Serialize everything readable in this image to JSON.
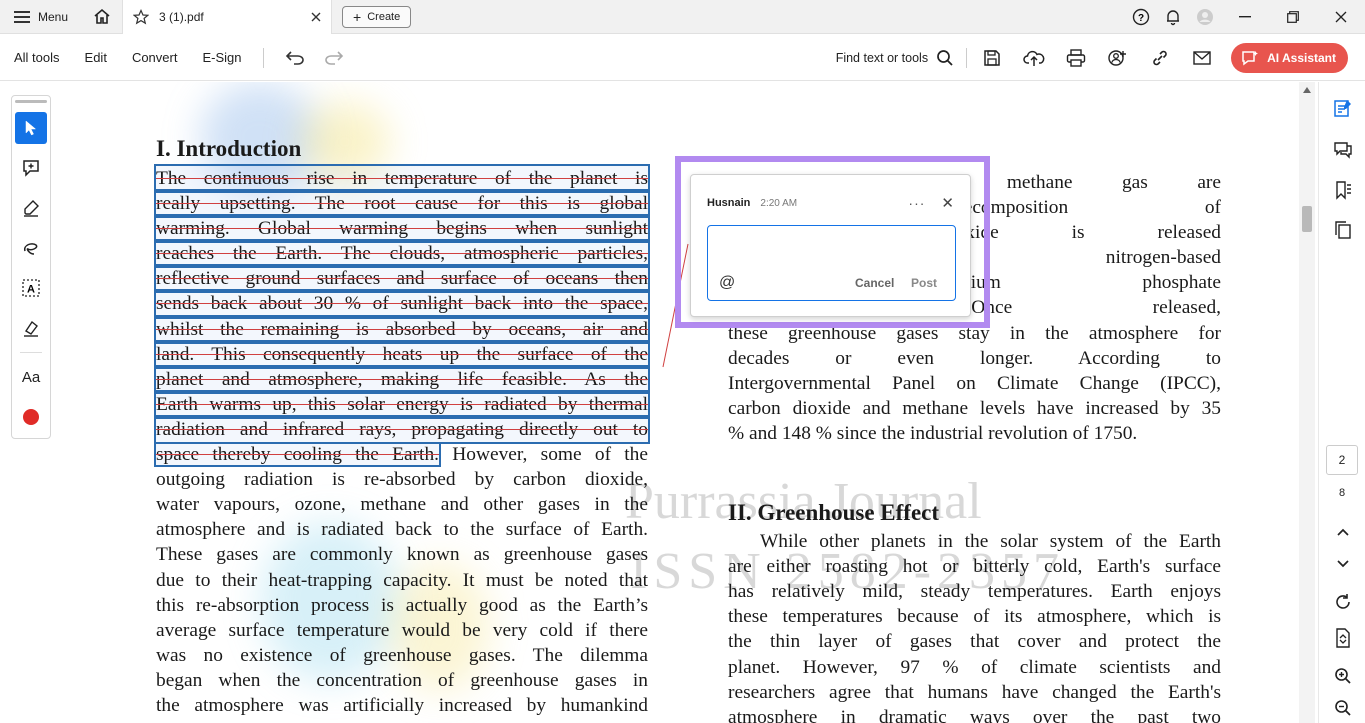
{
  "titlebar": {
    "menu_label": "Menu",
    "tab_title": "3 (1).pdf",
    "create_label": "Create"
  },
  "toolbar": {
    "all_tools": "All tools",
    "edit": "Edit",
    "convert": "Convert",
    "esign": "E-Sign",
    "find_placeholder": "Find text or tools",
    "ai_assistant": "AI Assistant"
  },
  "colors": {
    "accent": "#1473e6",
    "ai_button": "#e8554e",
    "highlight_outline": "#2b6cb0",
    "strike": "#d04040",
    "comment_frame": "#b28af0"
  },
  "document": {
    "watermark_line1": "Purrassia Journal",
    "watermark_line2": "ISSN 2582-2357",
    "left": {
      "heading": "I. Introduction",
      "highlighted_lines": [
        "The continuous rise in temperature of the planet is",
        "really upsetting. The root cause for this is global",
        "warming. Global warming begins when sunlight",
        "reaches the Earth. The clouds, atmospheric particles,",
        "reflective ground surfaces and surface of oceans then",
        "sends back about 30 % of sunlight back into the space,",
        "whilst the remaining is absorbed by oceans, air and",
        "land. This consequently heats up the surface of the",
        "planet and atmosphere, making life feasible. As the",
        "Earth warms up, this solar energy is radiated by thermal",
        "radiation and infrared rays, propagating directly out to"
      ],
      "mixed_line_highlighted": "space thereby cooling the Earth.",
      "mixed_line_rest": " However, some of the",
      "plain_lines": [
        "outgoing radiation is re-absorbed by carbon dioxide,",
        "water vapours, ozone, methane and other gases in the",
        "atmosphere and is radiated back to the surface of Earth.",
        "These gases are commonly known as greenhouse gases",
        "due to their heat-trapping capacity. It must be noted that",
        "this re-absorption process is actually good as the Earth’s",
        "average surface temperature would be very cold if there",
        "was no existence of greenhouse gases. The dilemma",
        "began when the concentration of greenhouse gases in",
        "the atmosphere was artificially increased by humankind"
      ]
    },
    "right": {
      "top_lines": [
        "Million pounds of methane gas are",
        "agricultural decomposition of",
        "the Nitrous oxide is released",
        "by various nitrogen-based",
        "and diammonium phosphate",
        "fertilizations. Once released,",
        "these greenhouse gases stay in the atmosphere for",
        "decades or even longer. According to",
        "Intergovernmental Panel on Climate Change (IPCC),",
        "carbon dioxide and methane levels have increased by 35",
        "% and 148 % since the industrial revolution of 1750."
      ],
      "heading": "II. Greenhouse Effect",
      "body_lines": [
        "While other planets in the solar system of the Earth",
        "are either roasting hot or bitterly cold, Earth's surface",
        "has relatively mild, steady temperatures. Earth enjoys",
        "these temperatures because of its atmosphere, which is",
        "the thin layer of gases that cover and protect the",
        "planet. However, 97 % of climate scientists and",
        "researchers agree that humans have changed the Earth's",
        "atmosphere in dramatic ways over the past two"
      ]
    }
  },
  "comment": {
    "author": "Husnain",
    "time": "2:20 AM",
    "more": "···",
    "close": "✕",
    "value": "",
    "at": "@",
    "cancel": "Cancel",
    "post": "Post"
  },
  "navigation": {
    "current_page": "2",
    "total_pages": "8"
  }
}
